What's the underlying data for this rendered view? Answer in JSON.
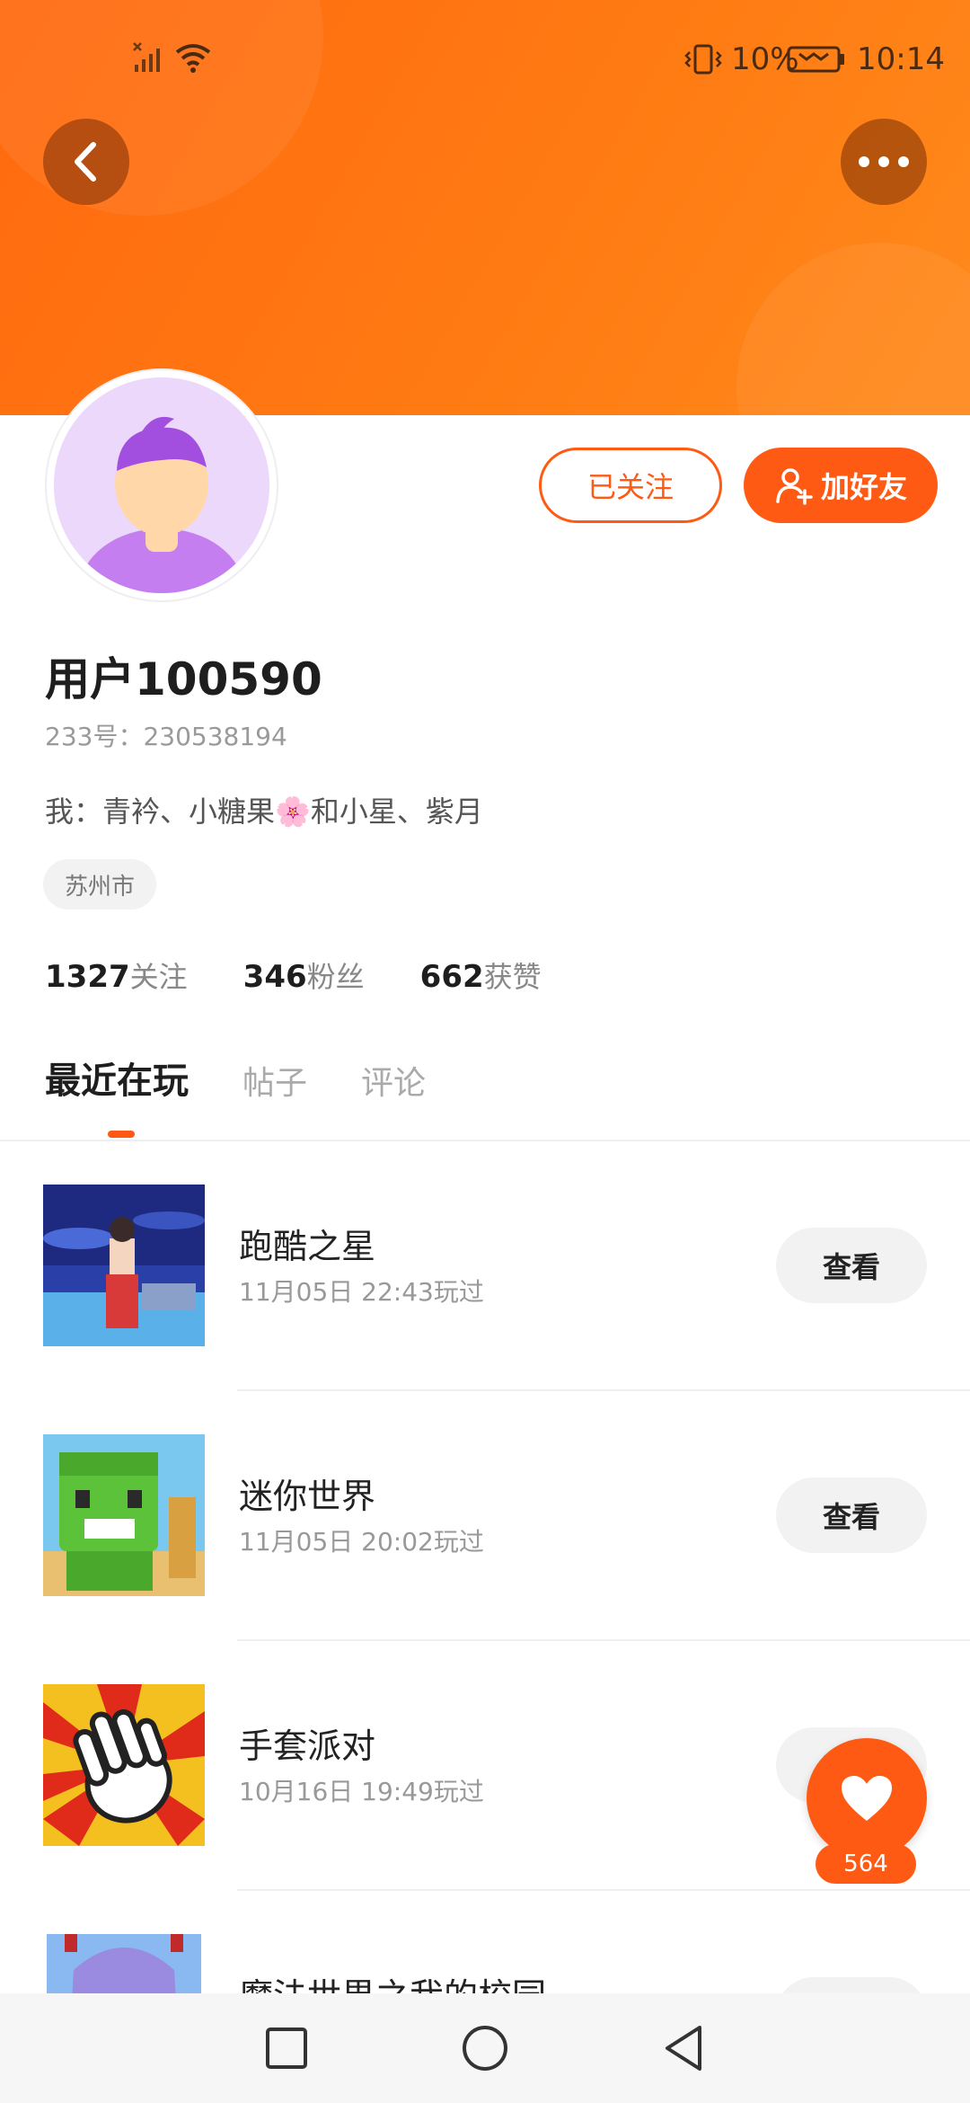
{
  "status_bar": {
    "battery_percent": "10%",
    "time": "10:14"
  },
  "header": {
    "back_icon": "chevron-left-icon",
    "more_icon": "more-horizontal-icon"
  },
  "profile": {
    "username": "用户100590",
    "user_id": "233号：230538194",
    "signature": "我：青衿、小糖果🌸和小星、紫月",
    "city": "苏州市",
    "follow_button": "已关注",
    "add_friend_button": "加好友",
    "stats": [
      {
        "num": "1327",
        "label": "关注"
      },
      {
        "num": "346",
        "label": "粉丝"
      },
      {
        "num": "662",
        "label": "获赞"
      }
    ]
  },
  "tabs": [
    {
      "label": "最近在玩",
      "active": true
    },
    {
      "label": "帖子",
      "active": false
    },
    {
      "label": "评论",
      "active": false
    }
  ],
  "games": [
    {
      "name": "跑酷之星",
      "time": "11月05日 22:43玩过",
      "button": "查看"
    },
    {
      "name": "迷你世界",
      "time": "11月05日 20:02玩过",
      "button": "查看"
    },
    {
      "name": "手套派对",
      "time": "10月16日 19:49玩过",
      "button": "查看"
    },
    {
      "name": "魔法世界之我的校园",
      "time": "",
      "button": "查看"
    }
  ],
  "like": {
    "count": "564"
  },
  "colors": {
    "accent": "#ff5a14",
    "banner": "#ff7a12"
  }
}
